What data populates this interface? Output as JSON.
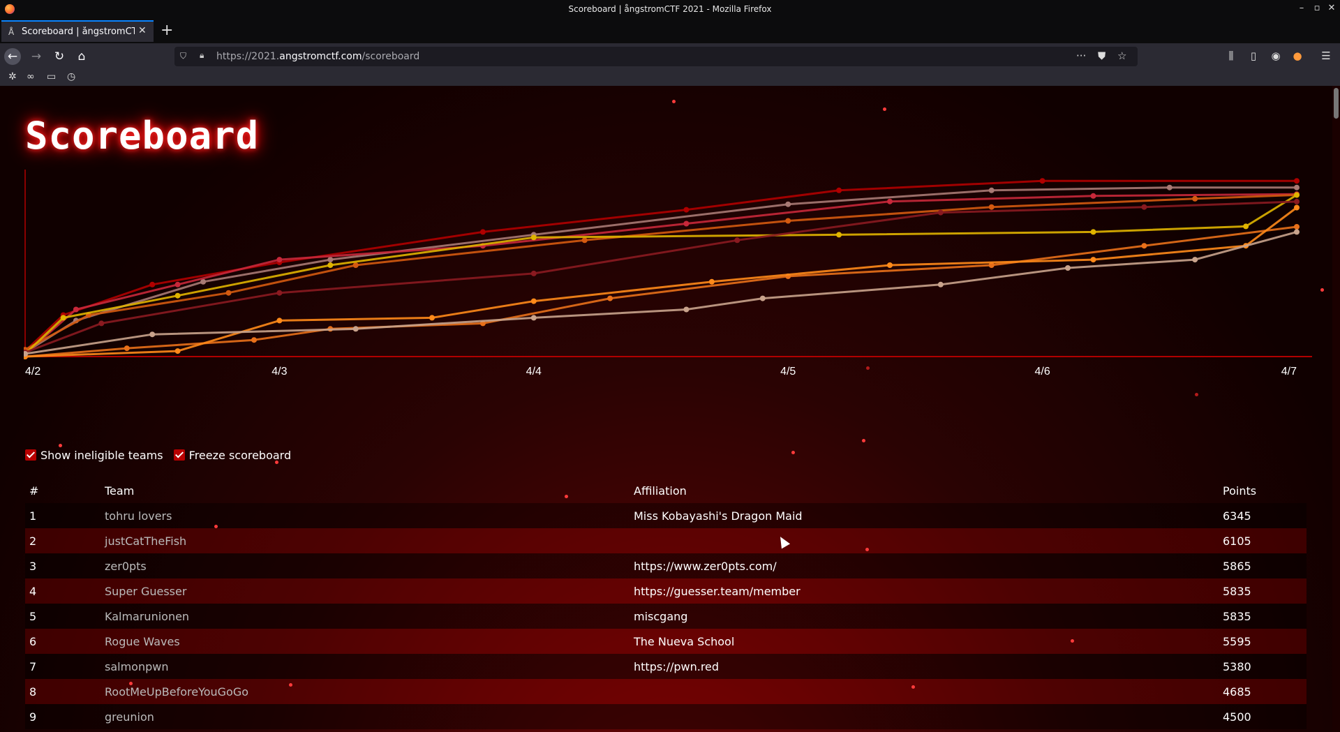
{
  "window": {
    "title": "Scoreboard | ångstromCTF 2021 - Mozilla Firefox"
  },
  "tab": {
    "title": "Scoreboard | ångstromCTF 2021"
  },
  "urlbar": {
    "url_prefix": "https://2021.",
    "url_domain": "angstromctf.com",
    "url_path": "/scoreboard"
  },
  "page": {
    "title": "Scoreboard"
  },
  "options": {
    "show_ineligible": "Show ineligible teams",
    "freeze": "Freeze scoreboard"
  },
  "table": {
    "headers": {
      "rank": "#",
      "team": "Team",
      "affiliation": "Affiliation",
      "points": "Points"
    },
    "rows": [
      {
        "rank": "1",
        "team": "tohru lovers",
        "affiliation": "Miss Kobayashi's Dragon Maid",
        "points": "6345"
      },
      {
        "rank": "2",
        "team": "justCatTheFish",
        "affiliation": "",
        "points": "6105"
      },
      {
        "rank": "3",
        "team": "zer0pts",
        "affiliation": "https://www.zer0pts.com/",
        "points": "5865"
      },
      {
        "rank": "4",
        "team": "Super Guesser",
        "affiliation": "https://guesser.team/member",
        "points": "5835"
      },
      {
        "rank": "5",
        "team": "Kalmarunionen",
        "affiliation": "miscgang",
        "points": "5835"
      },
      {
        "rank": "6",
        "team": "Rogue Waves",
        "affiliation": "The Nueva School",
        "points": "5595"
      },
      {
        "rank": "7",
        "team": "salmonpwn",
        "affiliation": "https://pwn.red",
        "points": "5380"
      },
      {
        "rank": "8",
        "team": "RootMeUpBeforeYouGoGo",
        "affiliation": "",
        "points": "4685"
      },
      {
        "rank": "9",
        "team": "greunion",
        "affiliation": "",
        "points": "4500"
      }
    ]
  },
  "chart_data": {
    "type": "line",
    "x_ticks": [
      "4/2",
      "4/3",
      "4/4",
      "4/5",
      "4/6",
      "4/7"
    ],
    "xlim": [
      0,
      5
    ],
    "ylim": [
      0,
      6500
    ],
    "series": [
      {
        "color": "#b00000",
        "points": [
          [
            0,
            200
          ],
          [
            0.15,
            1500
          ],
          [
            0.5,
            2600
          ],
          [
            1.0,
            3400
          ],
          [
            1.8,
            4500
          ],
          [
            2.6,
            5300
          ],
          [
            3.2,
            6000
          ],
          [
            4.0,
            6345
          ],
          [
            5,
            6345
          ]
        ]
      },
      {
        "color": "#a87a74",
        "points": [
          [
            0,
            150
          ],
          [
            0.2,
            1300
          ],
          [
            0.7,
            2700
          ],
          [
            1.2,
            3500
          ],
          [
            2.0,
            4400
          ],
          [
            3.0,
            5500
          ],
          [
            3.8,
            6000
          ],
          [
            4.5,
            6105
          ],
          [
            5,
            6105
          ]
        ]
      },
      {
        "color": "#c8283a",
        "points": [
          [
            0,
            100
          ],
          [
            0.2,
            1700
          ],
          [
            0.6,
            2600
          ],
          [
            1.0,
            3500
          ],
          [
            1.8,
            4000
          ],
          [
            2.6,
            4800
          ],
          [
            3.4,
            5600
          ],
          [
            4.2,
            5800
          ],
          [
            5,
            5865
          ]
        ]
      },
      {
        "color": "#d45a10",
        "points": [
          [
            0,
            250
          ],
          [
            0.25,
            1500
          ],
          [
            0.8,
            2300
          ],
          [
            1.3,
            3300
          ],
          [
            2.2,
            4200
          ],
          [
            3.0,
            4900
          ],
          [
            3.8,
            5400
          ],
          [
            4.6,
            5700
          ],
          [
            5,
            5835
          ]
        ]
      },
      {
        "color": "#e0b400",
        "points": [
          [
            0,
            100
          ],
          [
            0.15,
            1400
          ],
          [
            0.6,
            2200
          ],
          [
            1.2,
            3300
          ],
          [
            2.0,
            4300
          ],
          [
            3.2,
            4400
          ],
          [
            4.2,
            4500
          ],
          [
            4.8,
            4700
          ],
          [
            5,
            5835
          ]
        ]
      },
      {
        "color": "#8a1a20",
        "points": [
          [
            0,
            150
          ],
          [
            0.3,
            1200
          ],
          [
            1.0,
            2300
          ],
          [
            2.0,
            3000
          ],
          [
            2.8,
            4200
          ],
          [
            3.6,
            5200
          ],
          [
            4.4,
            5400
          ],
          [
            5,
            5595
          ]
        ]
      },
      {
        "color": "#e8701a",
        "points": [
          [
            0,
            0
          ],
          [
            0.4,
            300
          ],
          [
            0.9,
            600
          ],
          [
            1.2,
            1000
          ],
          [
            1.8,
            1200
          ],
          [
            2.3,
            2100
          ],
          [
            3.0,
            2900
          ],
          [
            3.8,
            3300
          ],
          [
            4.4,
            4000
          ],
          [
            5,
            4685
          ]
        ]
      },
      {
        "color": "#ff8a1a",
        "points": [
          [
            0,
            0
          ],
          [
            0.6,
            200
          ],
          [
            1.0,
            1300
          ],
          [
            1.6,
            1400
          ],
          [
            2.0,
            2000
          ],
          [
            2.7,
            2700
          ],
          [
            3.4,
            3300
          ],
          [
            4.2,
            3500
          ],
          [
            4.8,
            4000
          ],
          [
            5,
            5380
          ]
        ]
      },
      {
        "color": "#c9a38c",
        "points": [
          [
            0,
            100
          ],
          [
            0.5,
            800
          ],
          [
            1.3,
            1000
          ],
          [
            2.0,
            1400
          ],
          [
            2.6,
            1700
          ],
          [
            2.9,
            2100
          ],
          [
            3.6,
            2600
          ],
          [
            4.1,
            3200
          ],
          [
            4.6,
            3500
          ],
          [
            5,
            4500
          ]
        ]
      }
    ]
  }
}
